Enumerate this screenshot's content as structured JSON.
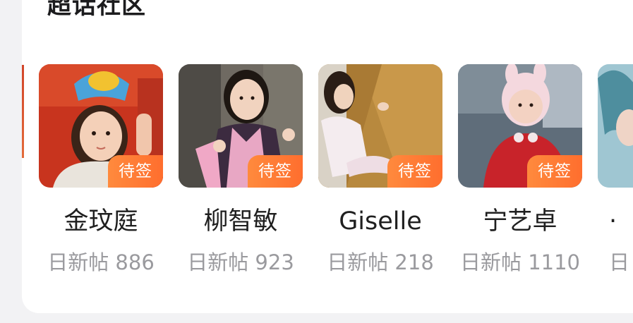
{
  "section": {
    "title": "超话社区"
  },
  "communities": [
    {
      "name": "金玟庭",
      "stat": "日新帖 886",
      "badge": "待签",
      "thumb_icon": "profile-photo"
    },
    {
      "name": "柳智敏",
      "stat": "日新帖 923",
      "badge": "待签",
      "thumb_icon": "profile-photo"
    },
    {
      "name": "Giselle",
      "stat": "日新帖 218",
      "badge": "待签",
      "thumb_icon": "profile-photo"
    },
    {
      "name": "宁艺卓",
      "stat": "日新帖 1110",
      "badge": "待签",
      "thumb_icon": "profile-photo"
    }
  ],
  "partial_item": {
    "name": "·",
    "stat": "日",
    "thumb_icon": "profile-photo"
  },
  "colors": {
    "badge_start": "#ff8a3d",
    "badge_end": "#ff6e2e",
    "title": "#1c1c1e",
    "stat": "#9a9a9e",
    "card": "#ffffff",
    "background": "#f2f2f4"
  }
}
